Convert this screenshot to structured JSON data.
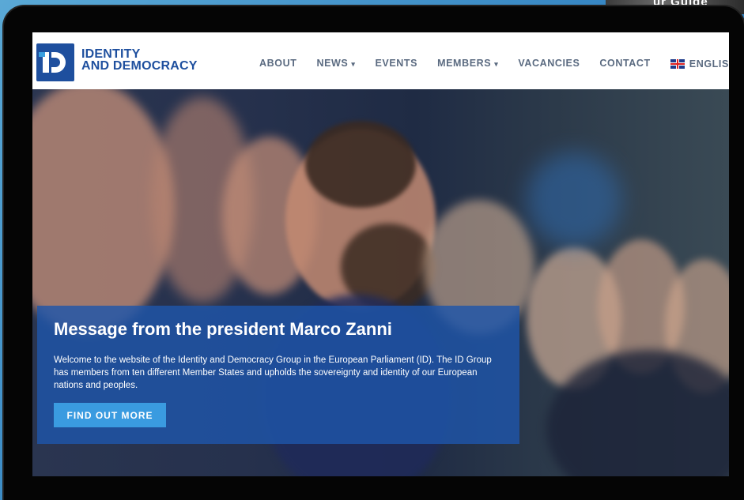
{
  "background": {
    "partial_text": "ur Guide"
  },
  "header": {
    "logo": {
      "line1": "IDENTITY",
      "line2": "AND DEMOCRACY"
    },
    "nav": [
      {
        "label": "ABOUT",
        "dropdown": false
      },
      {
        "label": "NEWS",
        "dropdown": true
      },
      {
        "label": "EVENTS",
        "dropdown": false
      },
      {
        "label": "MEMBERS",
        "dropdown": true
      },
      {
        "label": "VACANCIES",
        "dropdown": false
      },
      {
        "label": "CONTACT",
        "dropdown": false
      }
    ],
    "language": {
      "label": "ENGLISH",
      "icon": "uk-flag-icon"
    }
  },
  "hero": {
    "title": "Message from the president Marco Zanni",
    "text": "Welcome to the website of the Identity and Democracy Group in the European Parliament (ID). The ID Group has members from ten different Member States and upholds the sovereignty and identity of our European nations and peoples.",
    "button": "FIND OUT MORE",
    "image": "meeting-photo"
  },
  "colors": {
    "brand": "#1e4f9e",
    "accent": "#3a9be0",
    "nav_text": "#5a6a80",
    "card": "#1e56aa"
  }
}
